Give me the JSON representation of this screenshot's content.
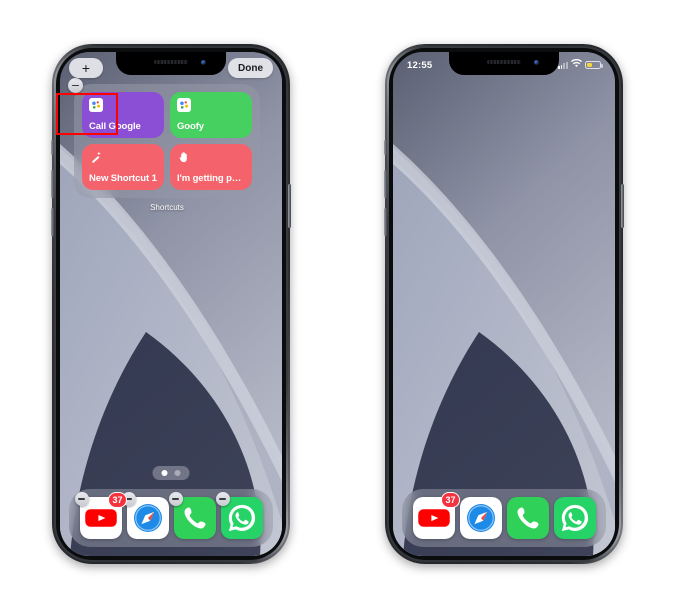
{
  "meta": {
    "scene": "ios-home-screen-jiggle-mode-comparison",
    "accent_red": "#ff0000"
  },
  "phone_left": {
    "name": "iphone-edit-mode",
    "edit_bar": {
      "add_label": "+",
      "done_label": "Done"
    },
    "widget": {
      "name": "Shortcuts",
      "delete_badge": "remove",
      "tiles": [
        {
          "label": "Call Google",
          "color": "#8a4fd4",
          "icon": "google-assistant-icon"
        },
        {
          "label": "Goofy",
          "color": "#45d05f",
          "icon": "google-assistant-icon"
        },
        {
          "label": "New Shortcut 1",
          "color": "#f4636b",
          "icon": "magic-wand-icon"
        },
        {
          "label": "I'm getting pul...",
          "color": "#f4636b",
          "icon": "raised-hand-icon"
        }
      ]
    },
    "page_dots": {
      "count": 2,
      "active_index": 0
    },
    "dock": [
      {
        "name": "YouTube",
        "icon": "youtube-icon",
        "badge": "37",
        "minus": true
      },
      {
        "name": "Safari",
        "icon": "safari-icon",
        "badge": "",
        "minus": true
      },
      {
        "name": "Phone",
        "icon": "phone-icon",
        "badge": "",
        "minus": true
      },
      {
        "name": "WhatsApp",
        "icon": "whatsapp-icon",
        "badge": "",
        "minus": true
      }
    ]
  },
  "phone_right": {
    "name": "iphone-normal-mode",
    "status_bar": {
      "time": "12:55",
      "signal": "signal-bars-icon",
      "wifi": "wifi-icon",
      "battery": "battery-low-power-icon",
      "battery_color": "#f6d43c"
    },
    "dock": [
      {
        "name": "YouTube",
        "icon": "youtube-icon",
        "badge": "37",
        "minus": false
      },
      {
        "name": "Safari",
        "icon": "safari-icon",
        "badge": "",
        "minus": false
      },
      {
        "name": "Phone",
        "icon": "phone-icon",
        "badge": "",
        "minus": false
      },
      {
        "name": "WhatsApp",
        "icon": "whatsapp-icon",
        "badge": "",
        "minus": false
      }
    ]
  }
}
